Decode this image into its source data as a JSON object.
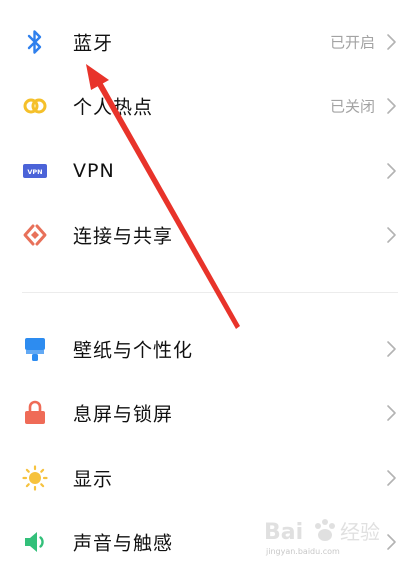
{
  "settings": {
    "items": [
      {
        "label": "蓝牙",
        "status": "已开启",
        "icon": "bluetooth-icon"
      },
      {
        "label": "个人热点",
        "status": "已关闭",
        "icon": "hotspot-icon"
      },
      {
        "label": "VPN",
        "status": "",
        "icon": "vpn-icon",
        "icon_text": "VPN"
      },
      {
        "label": "连接与共享",
        "status": "",
        "icon": "connect-share-icon"
      },
      {
        "label": "壁纸与个性化",
        "status": "",
        "icon": "wallpaper-icon"
      },
      {
        "label": "息屏与锁屏",
        "status": "",
        "icon": "lock-icon"
      },
      {
        "label": "显示",
        "status": "",
        "icon": "sun-icon"
      },
      {
        "label": "声音与触感",
        "status": "",
        "icon": "speaker-icon"
      }
    ]
  },
  "watermark": {
    "brand": "Bai 经验",
    "url": "jingyan.baidu.com"
  },
  "colors": {
    "bluetooth": "#2f80ed",
    "hotspot": "#f5c02a",
    "vpn": "#4b63d8",
    "connect": "#e8715a",
    "wallpaper": "#2d8cf0",
    "lock": "#ef6b57",
    "sun": "#f6c23e",
    "speaker": "#33c07a",
    "arrow": "#e8332a"
  }
}
